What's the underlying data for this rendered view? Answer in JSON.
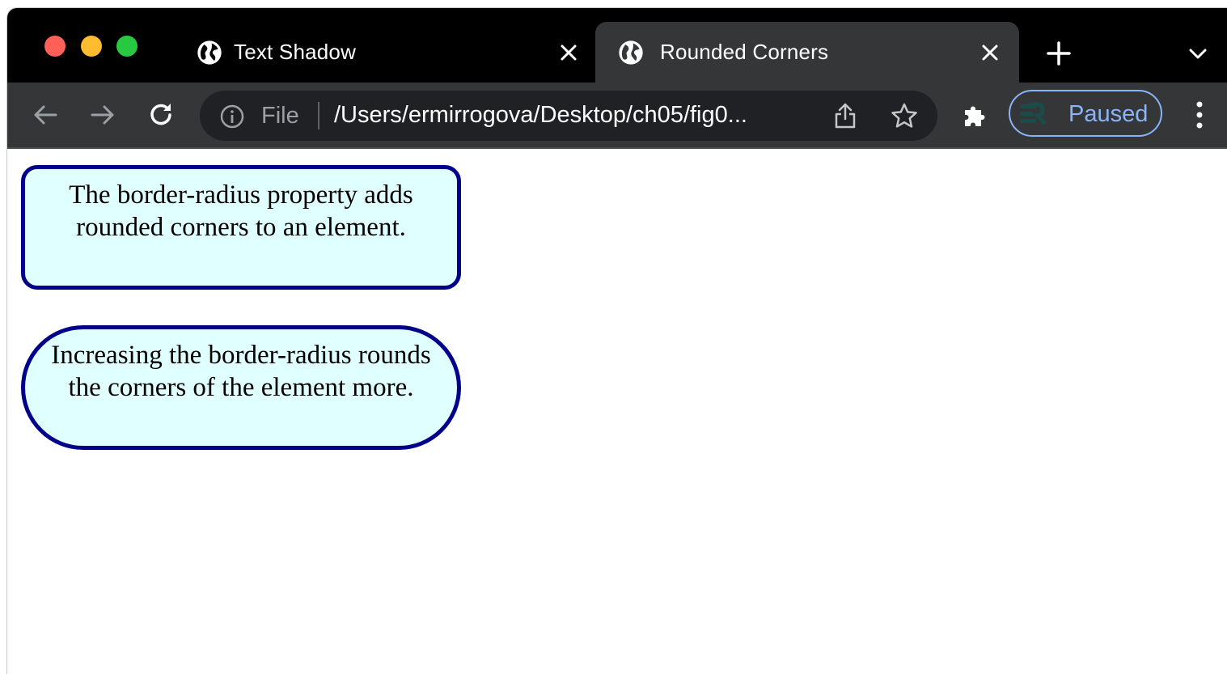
{
  "browser": {
    "tabs": [
      {
        "title": "Text Shadow",
        "active": false
      },
      {
        "title": "Rounded Corners",
        "active": true
      }
    ],
    "address_bar": {
      "scheme_label": "File",
      "url": "/Users/ermirrogova/Desktop/ch05/fig0..."
    },
    "profile": {
      "label": "Paused"
    }
  },
  "page": {
    "boxes": [
      {
        "text": "The border-radius property adds rounded corners to an element."
      },
      {
        "text": "Increasing the border-radius rounds the corners of the element more."
      }
    ]
  },
  "colors": {
    "box_border": "#00008b",
    "box_background": "#e0ffff",
    "accent": "#8ab4f8"
  }
}
